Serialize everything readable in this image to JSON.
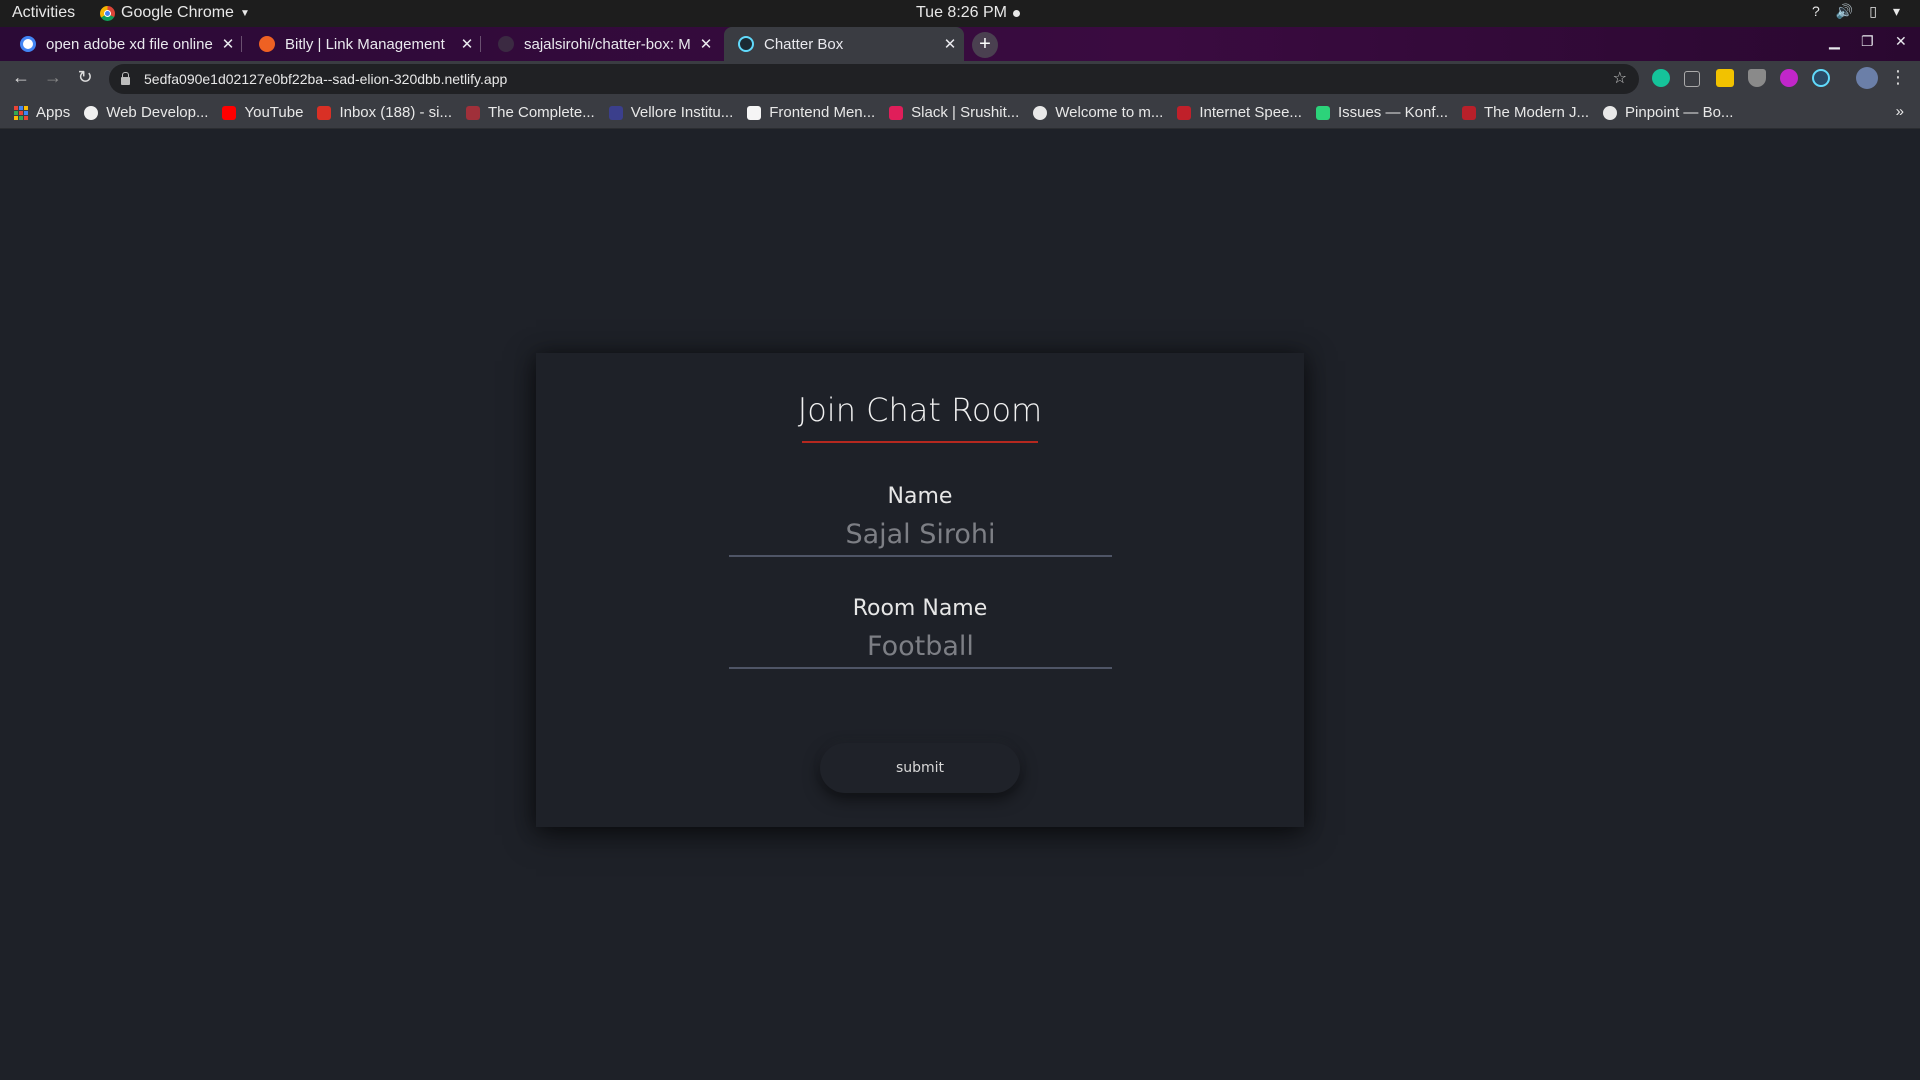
{
  "system_bar": {
    "activities": "Activities",
    "app_name": "Google Chrome",
    "clock": "Tue  8:26 PM"
  },
  "tabs": [
    {
      "title": "open adobe xd file online",
      "favicon": "google-icon"
    },
    {
      "title": "Bitly | Link Management",
      "favicon": "bitly-icon"
    },
    {
      "title": "sajalsirohi/chatter-box: M",
      "favicon": "github-icon"
    },
    {
      "title": "Chatter Box",
      "favicon": "react-icon",
      "active": true
    }
  ],
  "address_bar": {
    "url": "5edfa090e1d02127e0bf22ba--sad-elion-320dbb.netlify.app"
  },
  "bookmarks": [
    {
      "label": "Apps"
    },
    {
      "label": "Web Develop..."
    },
    {
      "label": "YouTube"
    },
    {
      "label": "Inbox (188) - si..."
    },
    {
      "label": "The Complete..."
    },
    {
      "label": "Vellore Institu..."
    },
    {
      "label": "Frontend Men..."
    },
    {
      "label": "Slack | Srushit..."
    },
    {
      "label": "Welcome to m..."
    },
    {
      "label": "Internet Spee..."
    },
    {
      "label": "Issues — Konf..."
    },
    {
      "label": "The Modern J..."
    },
    {
      "label": "Pinpoint — Bo..."
    }
  ],
  "form": {
    "title": "Join Chat Room",
    "name_label": "Name",
    "name_placeholder": "Sajal Sirohi",
    "room_label": "Room Name",
    "room_placeholder": "Football",
    "submit_label": "submit"
  },
  "colors": {
    "page_background": "#1e2128",
    "title_underline": "#b5281f",
    "field_underline": "#4f5566"
  }
}
